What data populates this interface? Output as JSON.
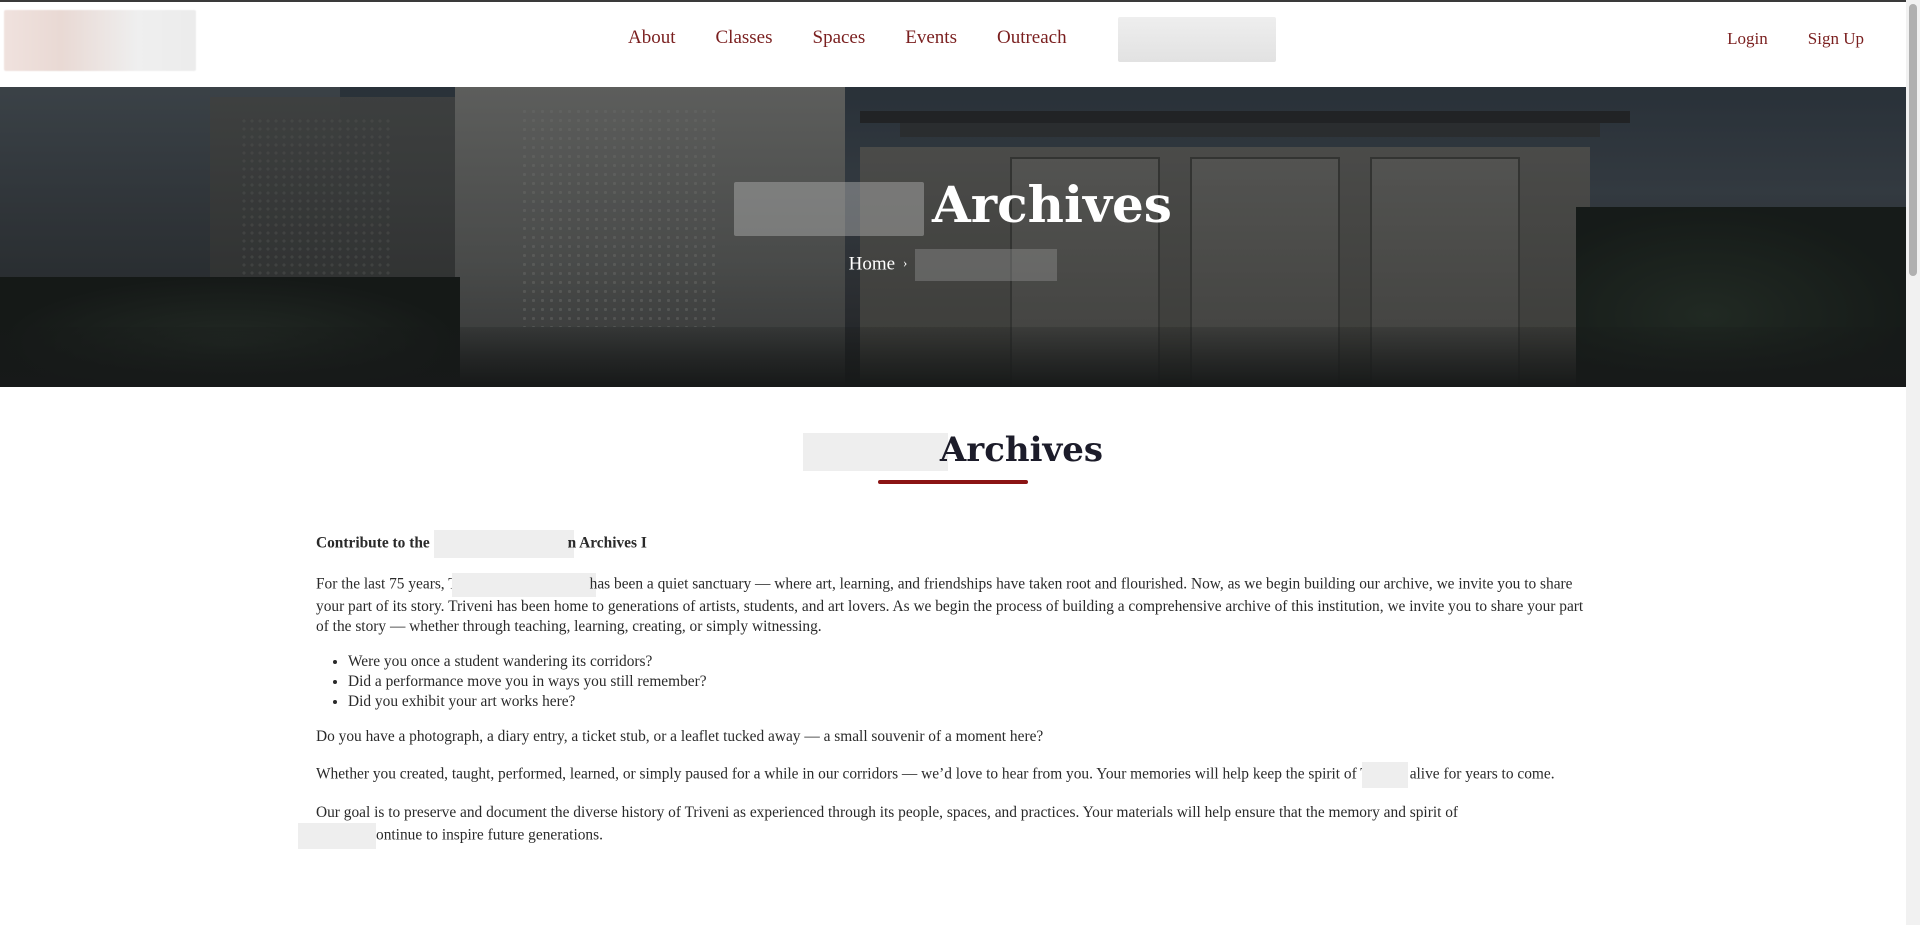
{
  "header": {
    "nav": [
      "About",
      "Classes",
      "Spaces",
      "Events",
      "Outreach"
    ],
    "auth": {
      "login": "Login",
      "signup": "Sign Up"
    }
  },
  "hero": {
    "title": "Archives",
    "breadcrumb_home": "Home",
    "breadcrumb_sep": "›"
  },
  "section": {
    "title": "Archives"
  },
  "body": {
    "lead_prefix": "Contribute to the",
    "lead_suffix": "n Archives I",
    "p1_a": "For the last 75 years, T",
    "p1_b": "has been a quiet sanctuary — where art, learning, and friendships have taken root and flourished. Now, as we begin building our archive, we invite you to share your part of its story. Triveni has been home to generations of artists, students, and art lovers. As we begin the process of building a comprehensive archive of this institution, we invite you to share your part of the story — whether through teaching, learning, creating, or simply witnessing.",
    "bullets": [
      "Were you once a student wandering its corridors?",
      "Did a performance move you in ways you still remember?",
      "Did you exhibit your art works here?"
    ],
    "p2": "Do you have a photograph, a diary entry, a ticket stub, or a leaflet tucked away — a small souvenir of a moment here?",
    "p3_a": "Whether you created, taught, performed, learned, or simply paused for a while in our corridors — we’d love to hear from you. Your memories will help keep the spirit of T",
    "p3_b": "alive for years to come.",
    "p4_a": "Our goal is to preserve and document the diverse history of Triveni as experienced through its people, spaces, and practices. Your materials will help ensure that the memory and spirit of",
    "p4_b": "ontinue to inspire future generations."
  }
}
